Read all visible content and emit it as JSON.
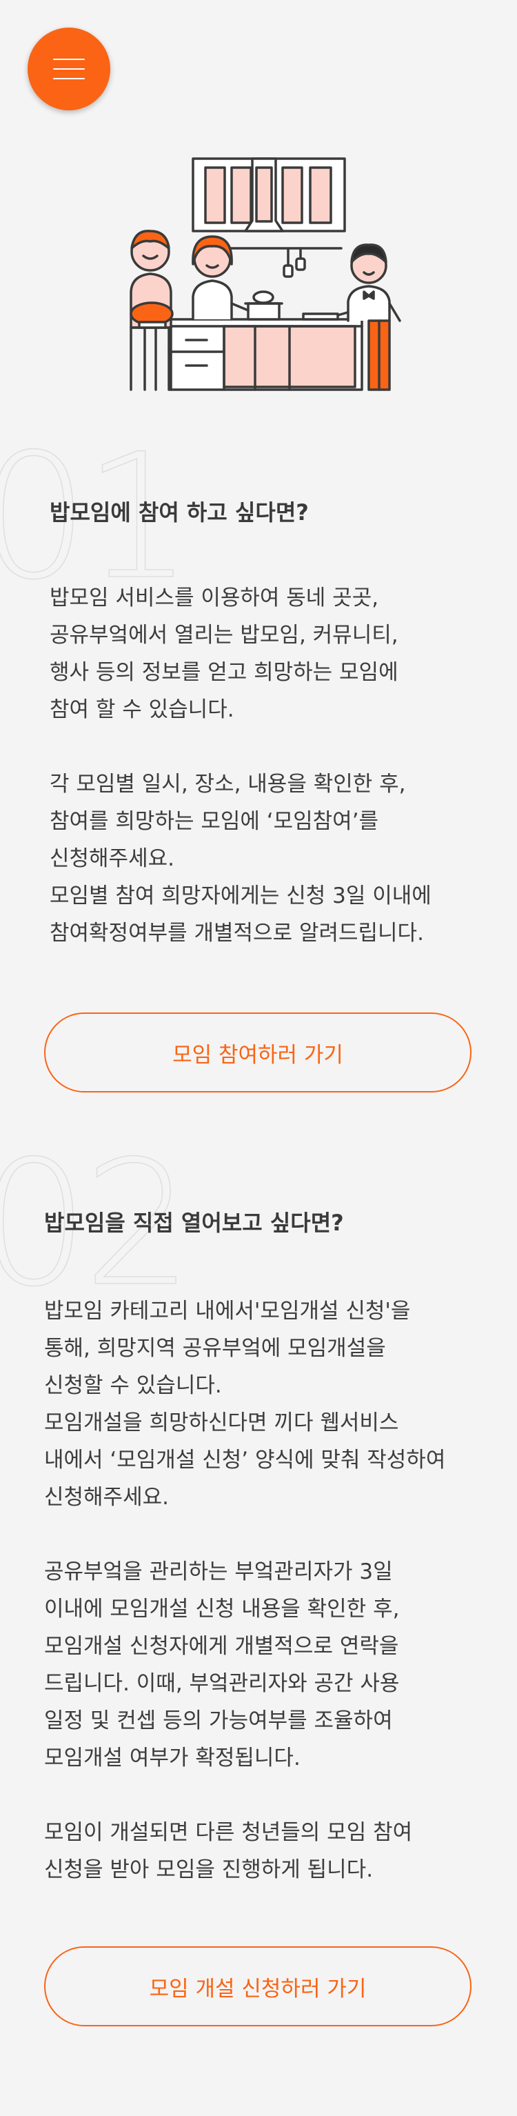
{
  "header": {
    "menu_icon": "hamburger-icon",
    "accent_color": "#fa6414"
  },
  "section1": {
    "number": "01",
    "title": "밥모임에 참여 하고 싶다면?",
    "paragraph1": "밥모임 서비스를 이용하여 동네 곳곳,\n공유부엌에서 열리는 밥모임, 커뮤니티,\n행사 등의 정보를 얻고 희망하는 모임에\n참여 할 수 있습니다.",
    "paragraph2": "각 모임별 일시, 장소, 내용을 확인한 후,\n참여를 희망하는 모임에 ‘모임참여’를\n신청해주세요.\n모임별 참여 희망자에게는 신청 3일 이내에\n참여확정여부를 개별적으로 알려드립니다.",
    "button_label": "모임 참여하러 가기"
  },
  "section2": {
    "number": "02",
    "title": "밥모임을 직접 열어보고 싶다면?",
    "paragraph1": "밥모임 카테고리 내에서'모임개설 신청'을\n통해, 희망지역 공유부엌에 모임개설을\n신청할 수 있습니다.\n모임개설을 희망하신다면 끼다 웹서비스\n내에서 ‘모임개설 신청’ 양식에 맞춰 작성하여\n신청해주세요.",
    "paragraph2": "공유부엌을 관리하는 부엌관리자가 3일\n이내에 모임개설 신청 내용을 확인한 후,\n모임개설 신청자에게 개별적으로 연락을\n드립니다. 이때, 부엌관리자와 공간 사용\n일정 및 컨셉 등의 가능여부를 조율하여\n모임개설 여부가 확정됩니다.",
    "paragraph3": "모임이 개설되면 다른 청년들의 모임 참여\n신청을 받아 모임을 진행하게 됩니다.",
    "button_label": "모임 개설 신청하러 가기"
  }
}
